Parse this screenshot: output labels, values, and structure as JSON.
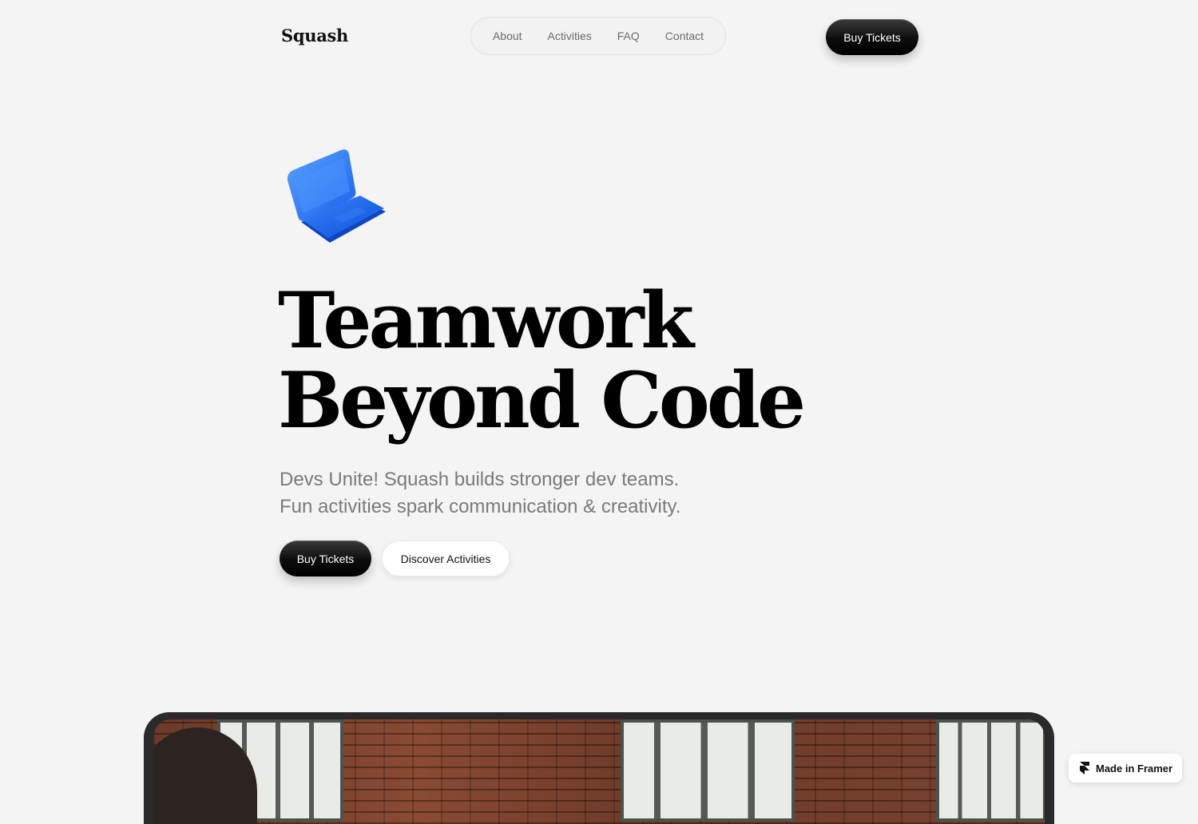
{
  "header": {
    "logo": "Squash",
    "nav": [
      "About",
      "Activities",
      "FAQ",
      "Contact"
    ],
    "cta_label": "Buy Tickets"
  },
  "hero": {
    "icon": "laptop-icon",
    "headline_line1": "Teamwork",
    "headline_line2": "Beyond Code",
    "subtitle_line1": "Devs Unite! Squash builds stronger dev teams.",
    "subtitle_line2": "Fun activities spark communication & creativity.",
    "primary_button": "Buy Tickets",
    "secondary_button": "Discover Activities"
  },
  "showcase": {
    "image": "team-photo-brick-office"
  },
  "badge": {
    "icon": "framer-icon",
    "label": "Made in Framer"
  },
  "colors": {
    "background": "#f4f4f4",
    "accent_dark": "#000000",
    "laptop_blue": "#1f6bff",
    "muted_text": "#7a7a7a"
  }
}
